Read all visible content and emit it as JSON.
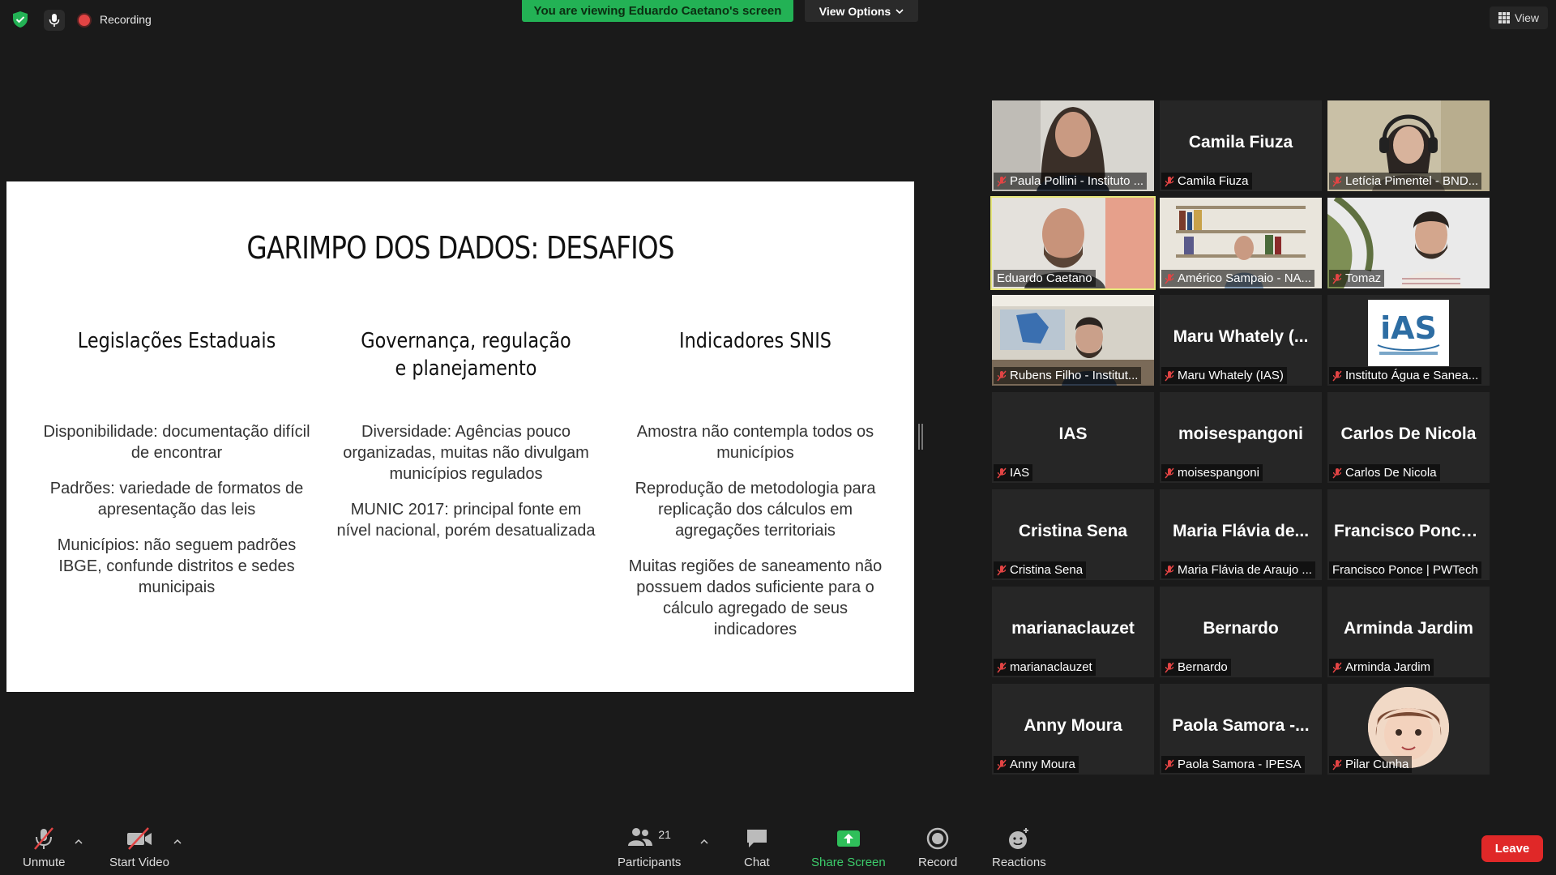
{
  "topbar": {
    "recording_label": "Recording",
    "viewing_banner": "You are viewing Eduardo Caetano's screen",
    "view_options_label": "View Options",
    "view_label": "View"
  },
  "slide": {
    "title": "GARIMPO DOS DADOS: DESAFIOS",
    "col1": {
      "heading": "Legislações Estaduais",
      "items": [
        "Disponibilidade: documentação difícil de encontrar",
        "Padrões: variedade de formatos de apresentação das leis",
        "Municípios: não seguem padrões IBGE, confunde distritos e sedes municipais"
      ]
    },
    "col2": {
      "heading_line1": "Governança, regulação",
      "heading_line2": "e planejamento",
      "items": [
        "Diversidade: Agências pouco organizadas, muitas não divulgam municípios regulados",
        "MUNIC 2017: principal fonte em nível nacional, porém desatualizada"
      ]
    },
    "col3": {
      "heading": "Indicadores SNIS",
      "items": [
        "Amostra não contempla todos os municípios",
        "Reprodução de metodologia para replicação dos cálculos em agregações territoriais",
        "Muitas regiões de saneamento não possuem dados suficiente para o cálculo agregado de seus indicadores"
      ]
    }
  },
  "participants": [
    {
      "big": "",
      "label": "Paula Pollini - Instituto ...",
      "video": true,
      "kind": "woman1"
    },
    {
      "big": "Camila Fiuza",
      "label": "Camila Fiuza",
      "video": false
    },
    {
      "big": "",
      "label": "Letícia Pimentel - BND...",
      "video": true,
      "kind": "woman2"
    },
    {
      "big": "",
      "label": "Eduardo Caetano",
      "video": true,
      "kind": "man1",
      "active": true,
      "unmuted": true
    },
    {
      "big": "",
      "label": "Américo Sampaio - NA...",
      "video": true,
      "kind": "shelf"
    },
    {
      "big": "",
      "label": "Tomaz",
      "video": true,
      "kind": "man2"
    },
    {
      "big": "",
      "label": "Rubens Filho - Institut...",
      "video": true,
      "kind": "office"
    },
    {
      "big": "Maru Whately (...",
      "label": "Maru Whately (IAS)",
      "video": false
    },
    {
      "big": "",
      "label": "Instituto Água e Sanea...",
      "video": true,
      "kind": "logo"
    },
    {
      "big": "IAS",
      "label": "IAS",
      "video": false
    },
    {
      "big": "moisespangoni",
      "label": "moisespangoni",
      "video": false
    },
    {
      "big": "Carlos De Nicola",
      "label": "Carlos De Nicola",
      "video": false
    },
    {
      "big": "Cristina Sena",
      "label": "Cristina Sena",
      "video": false
    },
    {
      "big": "Maria Flávia de...",
      "label": "Maria Flávia de Araujo ...",
      "video": false
    },
    {
      "big": "Francisco Ponce...",
      "label": "Francisco Ponce | PWTech",
      "video": false,
      "unmuted": true
    },
    {
      "big": "marianaclauzet",
      "label": "marianaclauzet",
      "video": false
    },
    {
      "big": "Bernardo",
      "label": "Bernardo",
      "video": false
    },
    {
      "big": "Arminda Jardim",
      "label": "Arminda Jardim",
      "video": false
    },
    {
      "big": "Anny Moura",
      "label": "Anny Moura",
      "video": false
    },
    {
      "big": "Paola Samora -...",
      "label": "Paola Samora - IPESA",
      "video": false
    },
    {
      "big": "",
      "label": "Pilar Cunha",
      "video": true,
      "kind": "avatar"
    }
  ],
  "toolbar": {
    "unmute_label": "Unmute",
    "start_video_label": "Start Video",
    "participants_label": "Participants",
    "participants_count": "21",
    "chat_label": "Chat",
    "share_screen_label": "Share Screen",
    "record_label": "Record",
    "reactions_label": "Reactions",
    "leave_label": "Leave"
  },
  "colors": {
    "banner_green": "#23b255",
    "share_green": "#3ccc6b",
    "leave_red": "#e02828",
    "active_speaker": "#e6e67a",
    "mute_red": "#e24444"
  }
}
